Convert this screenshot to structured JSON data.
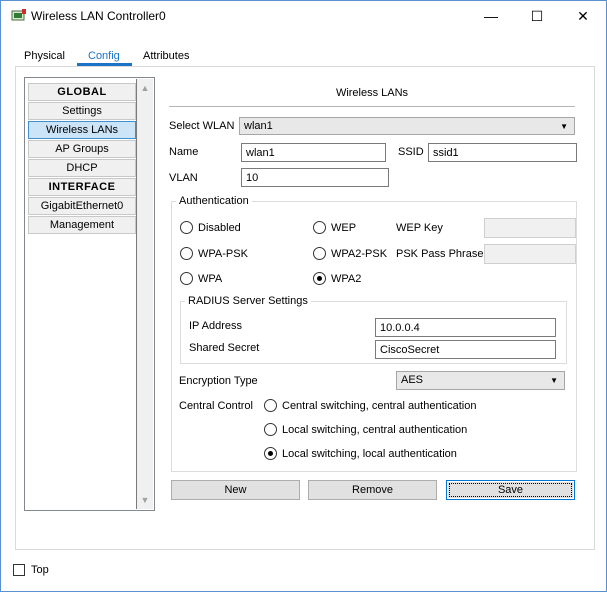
{
  "window": {
    "title": "Wireless LAN Controller0"
  },
  "tabs": [
    "Physical",
    "Config",
    "Attributes"
  ],
  "nav": {
    "items": [
      {
        "label": "GLOBAL",
        "header": true
      },
      {
        "label": "Settings"
      },
      {
        "label": "Wireless LANs",
        "selected": true
      },
      {
        "label": "AP Groups"
      },
      {
        "label": "DHCP"
      },
      {
        "label": "INTERFACE",
        "header": true
      },
      {
        "label": "GigabitEthernet0"
      },
      {
        "label": "Management"
      }
    ]
  },
  "section": {
    "title": "Wireless LANs"
  },
  "form": {
    "select_wlan_label": "Select WLAN",
    "select_wlan_value": "wlan1",
    "name_label": "Name",
    "name_value": "wlan1",
    "ssid_label": "SSID",
    "ssid_value": "ssid1",
    "vlan_label": "VLAN",
    "vlan_value": "10"
  },
  "auth": {
    "title": "Authentication",
    "options": {
      "disabled": "Disabled",
      "wep": "WEP",
      "wpa_psk": "WPA-PSK",
      "wpa2_psk": "WPA2-PSK",
      "wpa": "WPA",
      "wpa2": "WPA2"
    },
    "selected": "WPA2",
    "wep_key_label": "WEP Key",
    "psk_label": "PSK Pass Phrase"
  },
  "radius": {
    "title": "RADIUS Server Settings",
    "ip_label": "IP Address",
    "ip_value": "10.0.0.4",
    "secret_label": "Shared Secret",
    "secret_value": "CiscoSecret"
  },
  "encryption": {
    "label": "Encryption Type",
    "value": "AES"
  },
  "central": {
    "label": "Central Control",
    "options": [
      "Central switching, central authentication",
      "Local switching, central authentication",
      "Local switching, local authentication"
    ],
    "selected_index": 2
  },
  "buttons": {
    "new": "New",
    "remove": "Remove",
    "save": "Save"
  },
  "footer": {
    "top_label": "Top"
  }
}
